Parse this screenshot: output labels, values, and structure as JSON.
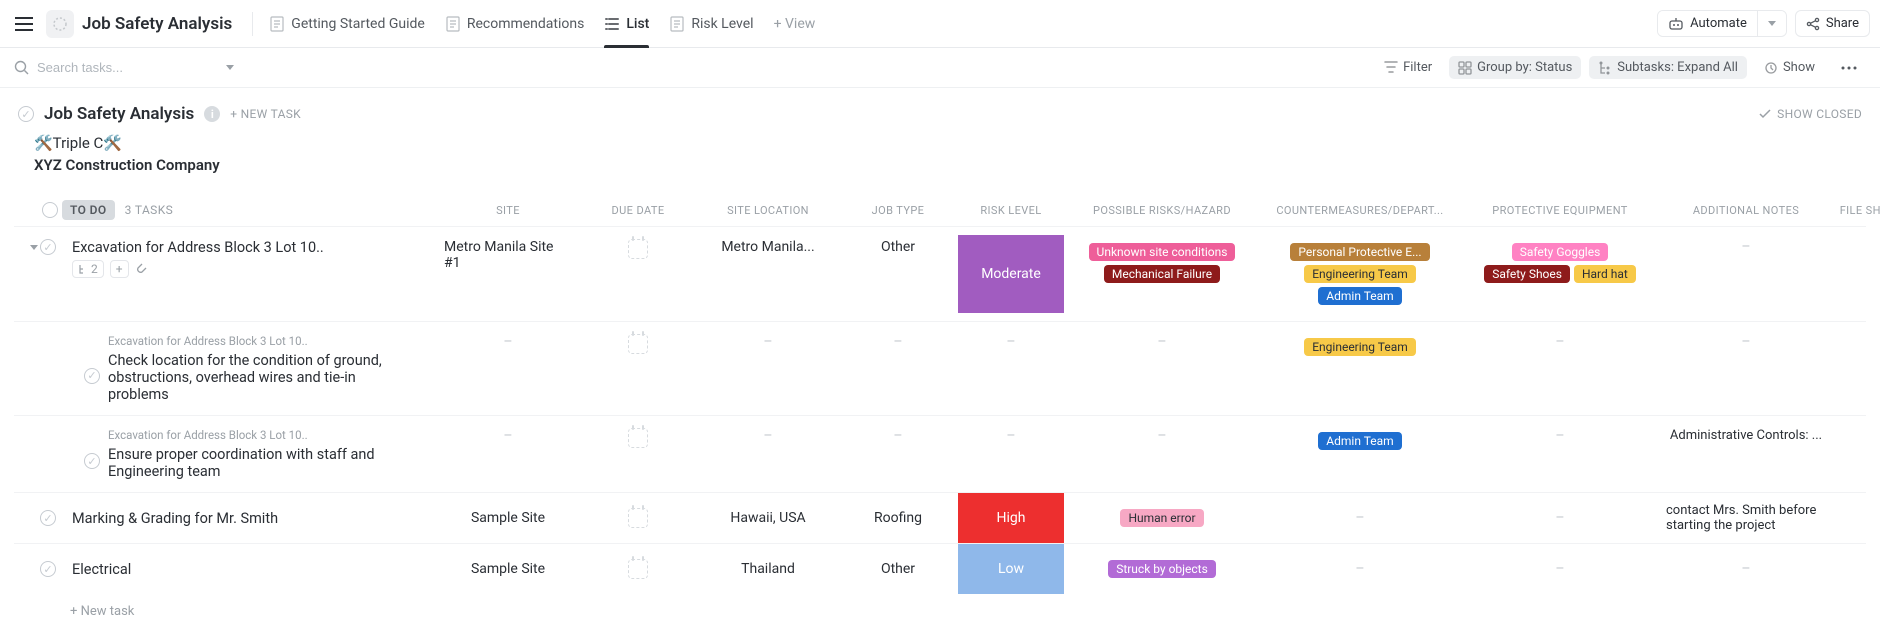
{
  "header": {
    "title": "Job Safety Analysis",
    "tabs": [
      {
        "label": "Getting Started Guide"
      },
      {
        "label": "Recommendations"
      },
      {
        "label": "List",
        "active": true
      },
      {
        "label": "Risk Level"
      },
      {
        "label": "+ View"
      }
    ],
    "automate": "Automate",
    "share": "Share"
  },
  "toolbar": {
    "search_placeholder": "Search tasks...",
    "filter": "Filter",
    "groupby": "Group by: Status",
    "subtasks": "Subtasks: Expand All",
    "show": "Show"
  },
  "list": {
    "title": "Job Safety Analysis",
    "new_task_label": "+ NEW TASK",
    "show_closed": "SHOW CLOSED",
    "desc_line1": "🛠️Triple C🛠️",
    "desc_line2": "XYZ Construction Company"
  },
  "group": {
    "status": "TO DO",
    "count": "3 TASKS",
    "new_task": "+ New task"
  },
  "columns": [
    "SITE",
    "DUE DATE",
    "SITE LOCATION",
    "JOB TYPE",
    "RISK LEVEL",
    "POSSIBLE RISKS/HAZARD",
    "COUNTERMEASURES/DEPART...",
    "PROTECTIVE EQUIPMENT",
    "ADDITIONAL NOTES",
    "FILE SHOWING THE STEP"
  ],
  "colors": {
    "unknown_site": "#ee5e99",
    "mechanical": "#8e1b1b",
    "ppe": "#b8803a",
    "engineering": "#f7c948",
    "admin": "#1f6fd1",
    "goggles": "#ff82c3",
    "shoes": "#8e1b1b",
    "hardhat": "#f7c948",
    "humanerror": "#f7a8c4",
    "struck": "#b26bd6"
  },
  "rows": [
    {
      "title": "Excavation for Address Block 3 Lot 10..",
      "subtask_count": "2",
      "site": "Metro Manila Site #1",
      "location": "Metro Manila...",
      "jobtype": "Other",
      "risk": "Moderate",
      "risk_class": "moderate",
      "hazards": [
        {
          "label": "Unknown site conditions",
          "color": "unknown_site"
        },
        {
          "label": "Mechanical Failure",
          "color": "mechanical"
        }
      ],
      "counter": [
        {
          "label": "Personal Protective E...",
          "color": "ppe"
        },
        {
          "label": "Engineering Team",
          "color": "engineering",
          "dark": true
        },
        {
          "label": "Admin Team",
          "color": "admin"
        }
      ],
      "equip": [
        {
          "label": "Safety Goggles",
          "color": "goggles"
        },
        {
          "label": "Safety Shoes",
          "color": "shoes"
        },
        {
          "label": "Hard hat",
          "color": "hardhat",
          "dark": true
        }
      ],
      "notes": "–",
      "file": "thumb",
      "subtasks": [
        {
          "crumb": "Excavation for Address Block 3 Lot 10..",
          "title": "Check location for the condition of ground, obstructions, overhead wires and tie-in problems",
          "counter": [
            {
              "label": "Engineering Team",
              "color": "engineering",
              "dark": true
            }
          ],
          "file": "doc"
        },
        {
          "crumb": "Excavation for Address Block 3 Lot 10..",
          "title": "Ensure proper coordination with staff and Engineering team",
          "counter": [
            {
              "label": "Admin Team",
              "color": "admin"
            }
          ],
          "notes": "Administrative Controls: ...",
          "file": "doc"
        }
      ]
    },
    {
      "title": "Marking & Grading for Mr. Smith",
      "site": "Sample Site",
      "location": "Hawaii, USA",
      "jobtype": "Roofing",
      "risk": "High",
      "risk_class": "high",
      "hazards": [
        {
          "label": "Human error",
          "color": "humanerror",
          "dark": true
        }
      ],
      "counter": [],
      "equip": [],
      "notes": "contact Mrs. Smith before starting the project",
      "file": "doc"
    },
    {
      "title": "Electrical",
      "site": "Sample Site",
      "location": "Thailand",
      "jobtype": "Other",
      "risk": "Low",
      "risk_class": "low",
      "hazards": [
        {
          "label": "Struck by objects",
          "color": "struck"
        }
      ],
      "counter": [],
      "equip": [],
      "notes": "–",
      "file": "doc"
    }
  ]
}
